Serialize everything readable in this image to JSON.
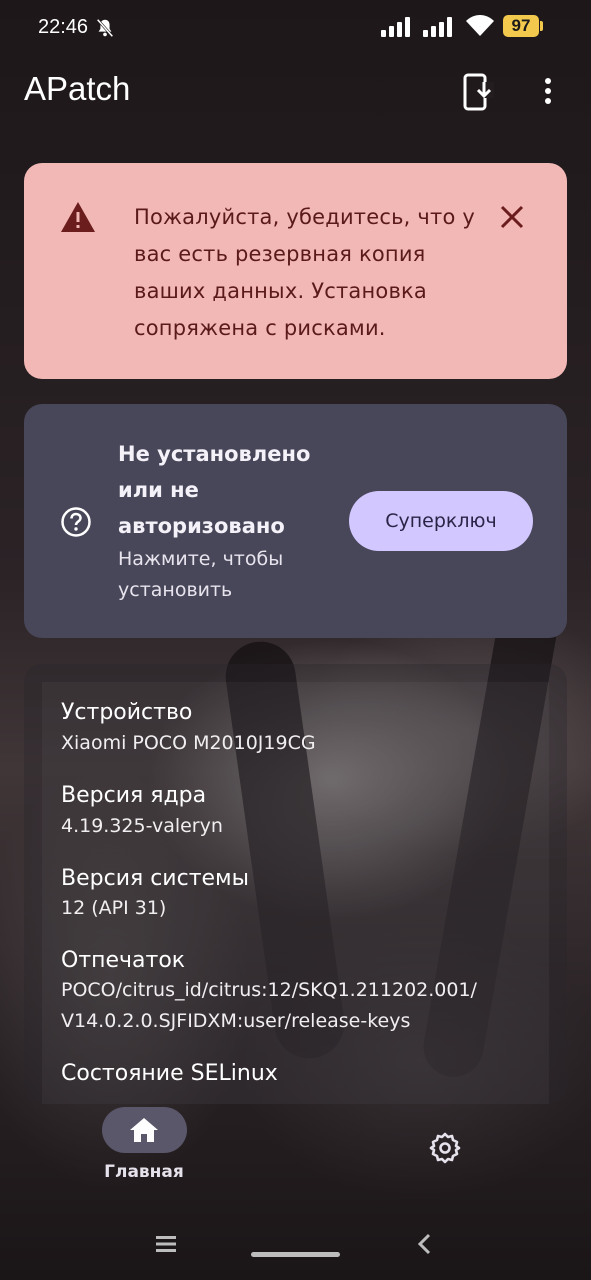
{
  "status_bar": {
    "time": "22:46",
    "battery": "97",
    "icons": [
      "bell-off-icon",
      "signal-icon",
      "signal-icon",
      "wifi-icon",
      "battery-icon"
    ]
  },
  "app_bar": {
    "title": "APatch",
    "actions": [
      "install-icon",
      "more-vert-icon"
    ]
  },
  "warning": {
    "text": "Пожалуйста, убедитесь, что у вас есть резервная копия ваших данных. Установка сопряжена с рисками.",
    "color": "#f2b8b5",
    "text_color": "#5b1a1a"
  },
  "status_card": {
    "title": "Не установлено или не авторизовано",
    "subtitle": "Нажмите, чтобы установить",
    "button_label": "Суперключ",
    "color": "#484759",
    "button_color": "#d2c7ff"
  },
  "info": {
    "device_label": "Устройство",
    "device_value": "Xiaomi POCO M2010J19CG",
    "kernel_label": "Версия ядра",
    "kernel_value": "4.19.325-valeryn",
    "system_label": "Версия системы",
    "system_value": "12  (API 31)",
    "fingerprint_label": "Отпечаток",
    "fingerprint_line1": "POCO/citrus_id/citrus:12/SKQ1.211202.001/",
    "fingerprint_line2": "V14.0.2.0.SJFIDXM:user/release-keys",
    "selinux_label": "Состояние SELinux"
  },
  "bottom_nav": {
    "home_label": "Главная",
    "items": [
      "home-icon",
      "settings-icon"
    ]
  }
}
